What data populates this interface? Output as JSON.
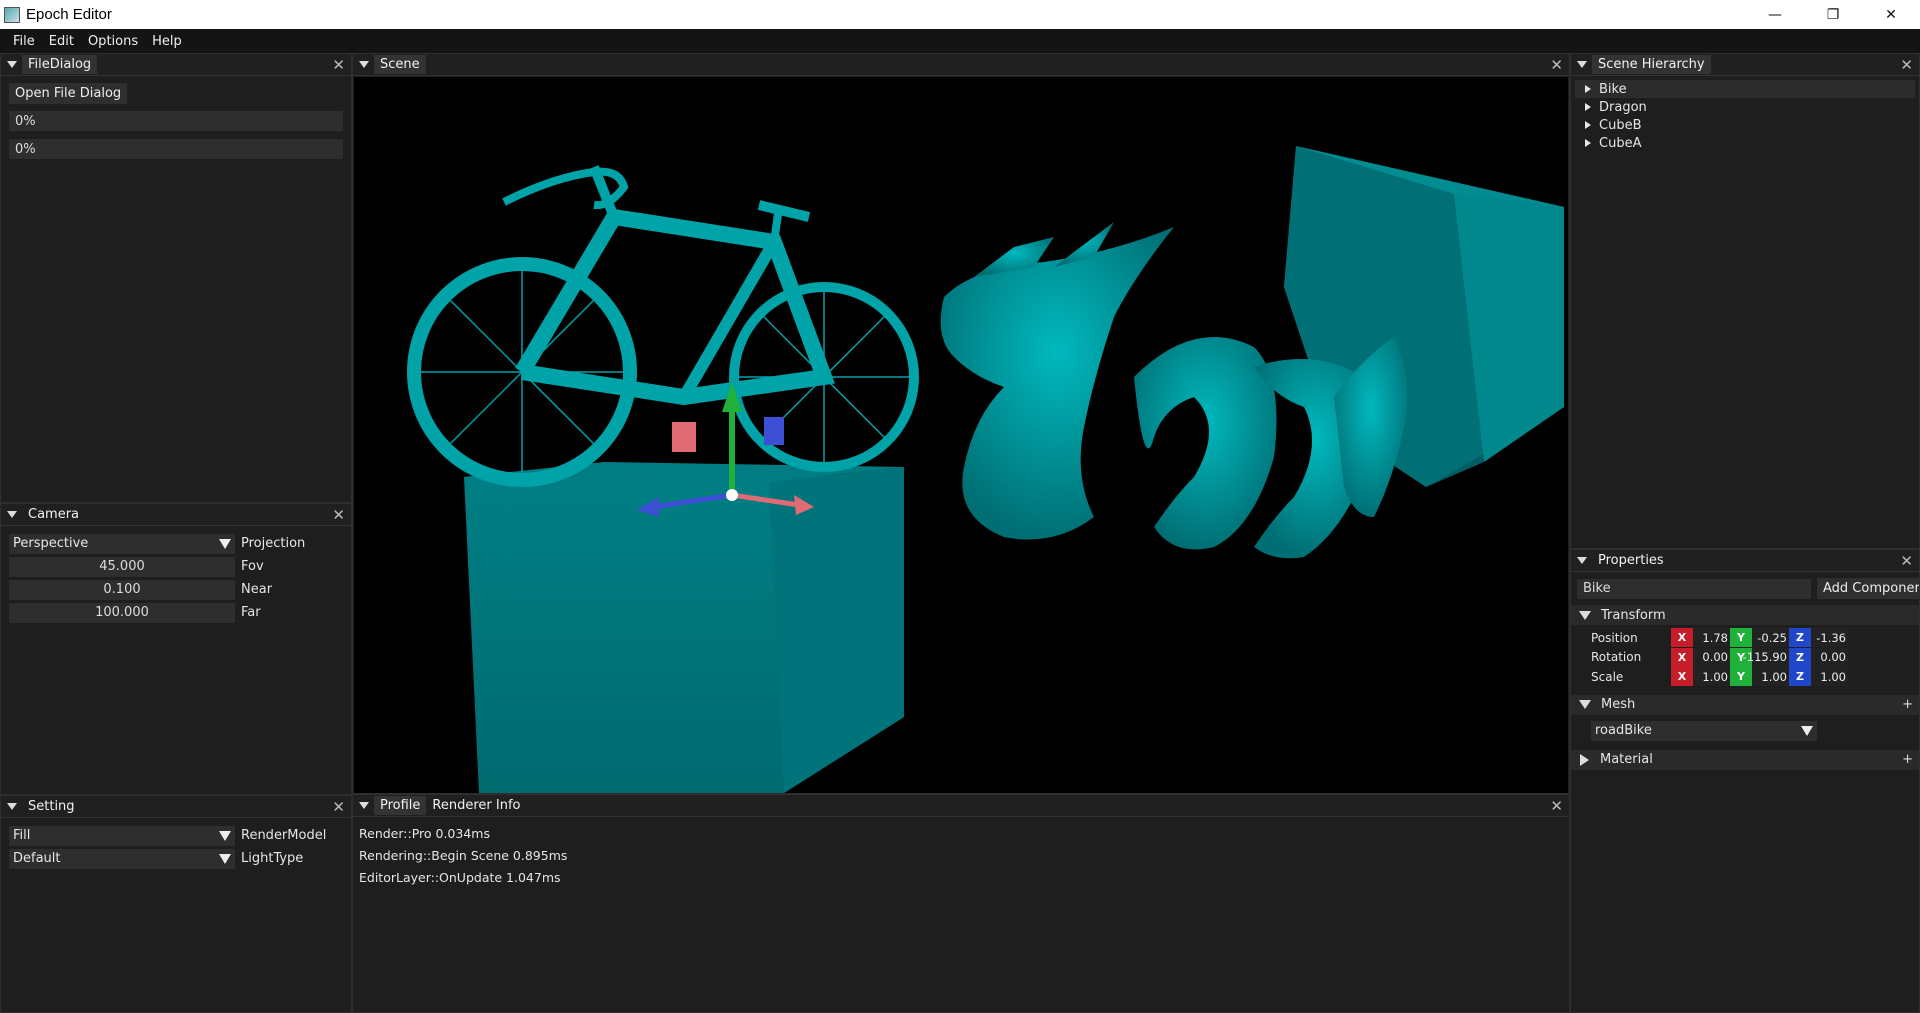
{
  "window": {
    "title": "Epoch Editor",
    "minimize_icon": "minimize-icon",
    "restore_icon": "restore-icon",
    "close_icon": "close-icon"
  },
  "menu": [
    "File",
    "Edit",
    "Options",
    "Help"
  ],
  "file_dialog": {
    "title": "FileDialog",
    "open_button": "Open File Dialog",
    "progress": [
      "0%",
      "0%"
    ]
  },
  "camera": {
    "title": "Camera",
    "projection_value": "Perspective",
    "projection_label": "Projection",
    "fov_value": "45.000",
    "fov_label": "Fov",
    "near_value": "0.100",
    "near_label": "Near",
    "far_value": "100.000",
    "far_label": "Far"
  },
  "setting": {
    "title": "Setting",
    "render_value": "Fill",
    "render_label": "RenderModel",
    "light_value": "Default",
    "light_label": "LightType"
  },
  "scene": {
    "title": "Scene",
    "accent": "#008b8b"
  },
  "profile": {
    "tab_profile": "Profile",
    "tab_renderer": "Renderer Info",
    "lines": [
      "Render::Pro  0.034ms",
      "Rendering::Begin Scene  0.895ms",
      "EditorLayer::OnUpdate  1.047ms"
    ]
  },
  "hierarchy": {
    "title": "Scene Hierarchy",
    "items": [
      "Bike",
      "Dragon",
      "CubeB",
      "CubeA"
    ]
  },
  "properties": {
    "title": "Properties",
    "name_value": "Bike",
    "add_component": "Add Componer",
    "transform_label": "Transform",
    "position_label": "Position",
    "position": [
      "1.78",
      "-0.25",
      "-1.36"
    ],
    "rotation_label": "Rotation",
    "rotation": [
      "0.00",
      "-115.90",
      "0.00"
    ],
    "scale_label": "Scale",
    "scale": [
      "1.00",
      "1.00",
      "1.00"
    ],
    "axis_x": "X",
    "axis_y": "Y",
    "axis_z": "Z",
    "mesh_label": "Mesh",
    "mesh_value": "roadBike",
    "material_label": "Material",
    "plus": "+"
  },
  "colors": {
    "axis_x": "#c61d2b",
    "axis_y": "#20b13a",
    "axis_z": "#2046c9",
    "model": "#009aa0"
  }
}
